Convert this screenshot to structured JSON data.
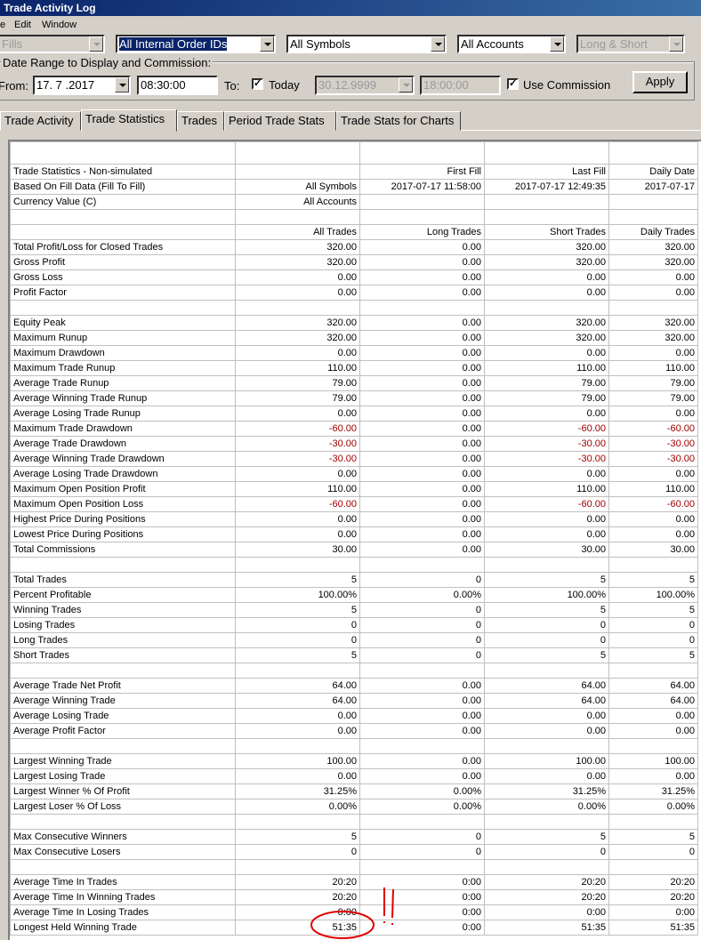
{
  "window": {
    "title": "Trade Activity Log"
  },
  "menu": [
    "e",
    "Edit",
    "Window"
  ],
  "filters": {
    "fills": "Fills",
    "order_ids": "All Internal Order IDs",
    "symbols": "All Symbols",
    "accounts": "All Accounts",
    "direction": "Long & Short"
  },
  "date_range": {
    "group_title": "Date Range to Display and Commission:",
    "from_label": "From:",
    "from_date": "17. 7 .2017",
    "from_time": "08:30:00",
    "to_label": "To:",
    "today_label": "Today",
    "to_date": "30.12.9999",
    "to_time": "18:00:00",
    "use_commission_label": "Use Commission",
    "apply_label": "Apply"
  },
  "tabs": [
    "Trade Activity",
    "Trade Statistics",
    "Trades",
    "Period Trade Stats",
    "Trade Stats for Charts"
  ],
  "active_tab": "Trade Statistics",
  "colors": {
    "negative": "#a00000",
    "annotation": "#e00000"
  },
  "stats": {
    "header_rows": [
      [
        "Trade Statistics - Non-simulated",
        "",
        "First Fill",
        "Last Fill",
        "Daily Date"
      ],
      [
        "Based On Fill Data (Fill To Fill)",
        "All Symbols",
        "2017-07-17  11:58:00",
        "2017-07-17  12:49:35",
        "2017-07-17"
      ],
      [
        "Currency Value (C)",
        "All Accounts",
        "",
        "",
        ""
      ],
      [
        "",
        "",
        "",
        "",
        ""
      ],
      [
        "",
        "All Trades",
        "Long Trades",
        "Short Trades",
        "Daily Trades"
      ]
    ],
    "rows": [
      [
        "Total Profit/Loss for Closed Trades",
        "320.00",
        "0.00",
        "320.00",
        "320.00"
      ],
      [
        "Gross Profit",
        "320.00",
        "0.00",
        "320.00",
        "320.00"
      ],
      [
        "Gross Loss",
        "0.00",
        "0.00",
        "0.00",
        "0.00"
      ],
      [
        "Profit Factor",
        "0.00",
        "0.00",
        "0.00",
        "0.00"
      ],
      [
        "",
        "",
        "",
        "",
        ""
      ],
      [
        "Equity Peak",
        "320.00",
        "0.00",
        "320.00",
        "320.00"
      ],
      [
        "Maximum Runup",
        "320.00",
        "0.00",
        "320.00",
        "320.00"
      ],
      [
        "Maximum Drawdown",
        "0.00",
        "0.00",
        "0.00",
        "0.00"
      ],
      [
        "Maximum Trade Runup",
        "110.00",
        "0.00",
        "110.00",
        "110.00"
      ],
      [
        "Average Trade Runup",
        "79.00",
        "0.00",
        "79.00",
        "79.00"
      ],
      [
        "Average Winning Trade Runup",
        "79.00",
        "0.00",
        "79.00",
        "79.00"
      ],
      [
        "Average Losing Trade Runup",
        "0.00",
        "0.00",
        "0.00",
        "0.00"
      ],
      [
        "Maximum Trade Drawdown",
        "-60.00",
        "0.00",
        "-60.00",
        "-60.00"
      ],
      [
        "Average Trade Drawdown",
        "-30.00",
        "0.00",
        "-30.00",
        "-30.00"
      ],
      [
        "Average Winning Trade Drawdown",
        "-30.00",
        "0.00",
        "-30.00",
        "-30.00"
      ],
      [
        "Average Losing Trade Drawdown",
        "0.00",
        "0.00",
        "0.00",
        "0.00"
      ],
      [
        "Maximum Open Position Profit",
        "110.00",
        "0.00",
        "110.00",
        "110.00"
      ],
      [
        "Maximum Open Position Loss",
        "-60.00",
        "0.00",
        "-60.00",
        "-60.00"
      ],
      [
        "Highest Price During Positions",
        "0.00",
        "0.00",
        "0.00",
        "0.00"
      ],
      [
        "Lowest Price During Positions",
        "0.00",
        "0.00",
        "0.00",
        "0.00"
      ],
      [
        "Total Commissions",
        "30.00",
        "0.00",
        "30.00",
        "30.00"
      ],
      [
        "",
        "",
        "",
        "",
        ""
      ],
      [
        "Total Trades",
        "5",
        "0",
        "5",
        "5"
      ],
      [
        "Percent Profitable",
        "100.00%",
        "0.00%",
        "100.00%",
        "100.00%"
      ],
      [
        "Winning Trades",
        "5",
        "0",
        "5",
        "5"
      ],
      [
        "Losing Trades",
        "0",
        "0",
        "0",
        "0"
      ],
      [
        "Long Trades",
        "0",
        "0",
        "0",
        "0"
      ],
      [
        "Short Trades",
        "5",
        "0",
        "5",
        "5"
      ],
      [
        "",
        "",
        "",
        "",
        ""
      ],
      [
        "Average Trade Net Profit",
        "64.00",
        "0.00",
        "64.00",
        "64.00"
      ],
      [
        "Average Winning Trade",
        "64.00",
        "0.00",
        "64.00",
        "64.00"
      ],
      [
        "Average Losing Trade",
        "0.00",
        "0.00",
        "0.00",
        "0.00"
      ],
      [
        "Average Profit Factor",
        "0.00",
        "0.00",
        "0.00",
        "0.00"
      ],
      [
        "",
        "",
        "",
        "",
        ""
      ],
      [
        "Largest Winning Trade",
        "100.00",
        "0.00",
        "100.00",
        "100.00"
      ],
      [
        "Largest Losing Trade",
        "0.00",
        "0.00",
        "0.00",
        "0.00"
      ],
      [
        "Largest Winner % Of Profit",
        "31.25%",
        "0.00%",
        "31.25%",
        "31.25%"
      ],
      [
        "Largest Loser % Of Loss",
        "0.00%",
        "0.00%",
        "0.00%",
        "0.00%"
      ],
      [
        "",
        "",
        "",
        "",
        ""
      ],
      [
        "Max Consecutive Winners",
        "5",
        "0",
        "5",
        "5"
      ],
      [
        "Max Consecutive Losers",
        "0",
        "0",
        "0",
        "0"
      ],
      [
        "",
        "",
        "",
        "",
        ""
      ],
      [
        "Average Time In Trades",
        "20:20",
        "0:00",
        "20:20",
        "20:20"
      ],
      [
        "Average Time In Winning Trades",
        "20:20",
        "0:00",
        "20:20",
        "20:20"
      ],
      [
        "Average Time In Losing Trades",
        "0:00",
        "0:00",
        "0:00",
        "0:00"
      ],
      [
        "Longest Held Winning Trade",
        "51:35",
        "0:00",
        "51:35",
        "51:35"
      ]
    ]
  }
}
